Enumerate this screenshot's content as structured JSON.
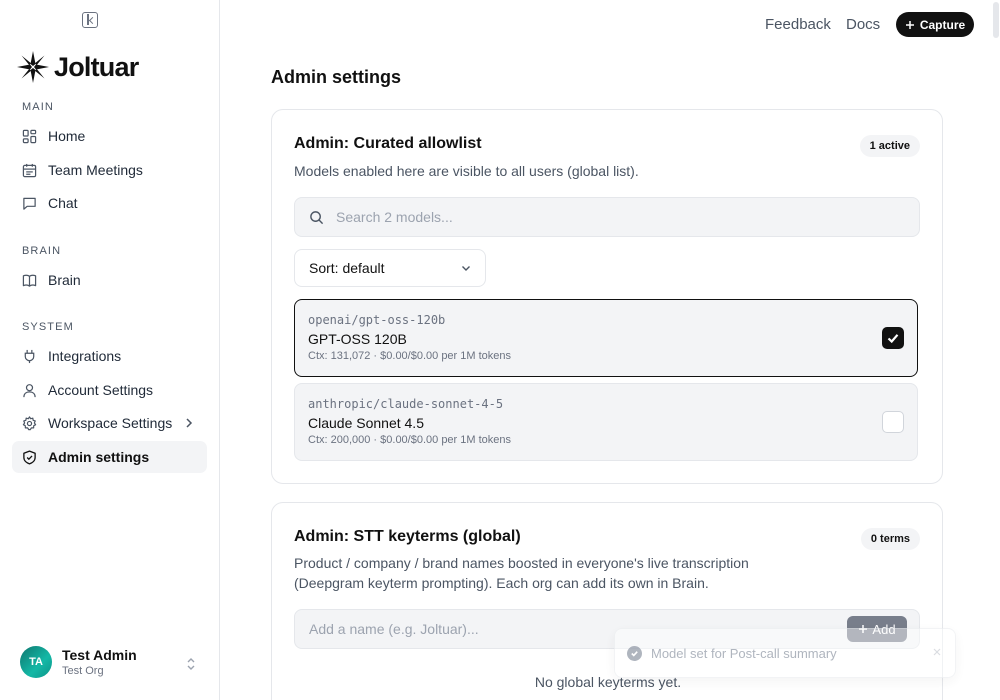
{
  "app": {
    "name": "Joltuar"
  },
  "topbar": {
    "feedback": "Feedback",
    "docs": "Docs",
    "capture": "Capture"
  },
  "sidebar": {
    "sections": [
      {
        "label": "MAIN",
        "items": [
          {
            "label": "Home",
            "icon": "grid-icon"
          },
          {
            "label": "Team Meetings",
            "icon": "calendar-icon"
          },
          {
            "label": "Chat",
            "icon": "message-icon"
          }
        ]
      },
      {
        "label": "BRAIN",
        "items": [
          {
            "label": "Brain",
            "icon": "book-icon"
          }
        ]
      },
      {
        "label": "SYSTEM",
        "items": [
          {
            "label": "Integrations",
            "icon": "plug-icon"
          },
          {
            "label": "Account Settings",
            "icon": "user-icon"
          },
          {
            "label": "Workspace Settings",
            "icon": "gear-icon"
          },
          {
            "label": "Admin settings",
            "icon": "shield-icon",
            "active": true
          }
        ]
      }
    ],
    "user": {
      "initials": "TA",
      "name": "Test Admin",
      "org": "Test Org"
    }
  },
  "page": {
    "title": "Admin settings"
  },
  "allowlist": {
    "title": "Admin: Curated allowlist",
    "badge": "1 active",
    "description": "Models enabled here are visible to all users (global list).",
    "search_placeholder": "Search 2 models...",
    "sort_label": "Sort: default",
    "models": [
      {
        "id": "openai/gpt-oss-120b",
        "name": "GPT-OSS 120B",
        "meta": "Ctx: 131,072 · $0.00/$0.00 per 1M tokens",
        "checked": true
      },
      {
        "id": "anthropic/claude-sonnet-4-5",
        "name": "Claude Sonnet 4.5",
        "meta": "Ctx: 200,000 · $0.00/$0.00 per 1M tokens",
        "checked": false
      }
    ]
  },
  "keyterms": {
    "title": "Admin: STT keyterms (global)",
    "badge": "0 terms",
    "description_line1": "Product / company / brand names boosted in everyone's live transcription",
    "description_line2": "(Deepgram keyterm prompting). Each org can add its own in Brain.",
    "input_placeholder": "Add a name (e.g. Joltuar)...",
    "add_label": "Add",
    "empty_text": "No global keyterms yet."
  },
  "toast": {
    "message": "Model set for Post-call summary"
  },
  "colors": {
    "primary": "#111111",
    "muted_bg": "#f3f4f6",
    "border": "#e5e7eb"
  }
}
